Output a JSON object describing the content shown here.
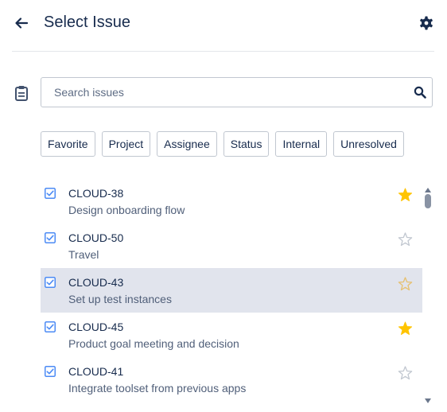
{
  "header": {
    "title": "Select Issue",
    "back_icon": "arrow-left-icon",
    "settings_icon": "gear-icon"
  },
  "search": {
    "placeholder": "Search issues",
    "value": "",
    "icon": "search-icon",
    "leading_icon": "clipboard-icon"
  },
  "filters": [
    "Favorite",
    "Project",
    "Assignee",
    "Status",
    "Internal",
    "Unresolved"
  ],
  "issues": [
    {
      "key": "CLOUD-38",
      "summary": "Design onboarding flow",
      "checked": true,
      "starred": true,
      "selected": false
    },
    {
      "key": "CLOUD-50",
      "summary": "Travel",
      "checked": true,
      "starred": false,
      "selected": false
    },
    {
      "key": "CLOUD-43",
      "summary": "Set up test instances",
      "checked": true,
      "starred": false,
      "selected": true
    },
    {
      "key": "CLOUD-45",
      "summary": "Product goal meeting and decision",
      "checked": true,
      "starred": true,
      "selected": false
    },
    {
      "key": "CLOUD-41",
      "summary": "Integrate toolset from previous apps",
      "checked": true,
      "starred": false,
      "selected": false
    }
  ],
  "colors": {
    "accent": "#0052cc",
    "checkbox": "#4c8bf5",
    "star_filled": "#ffc400",
    "star_outline": "#c1c7d0",
    "star_outline_selected": "#e6c070",
    "selected_row": "#e1e4ed",
    "text": "#172b4d",
    "secondary_text": "#505f79"
  }
}
